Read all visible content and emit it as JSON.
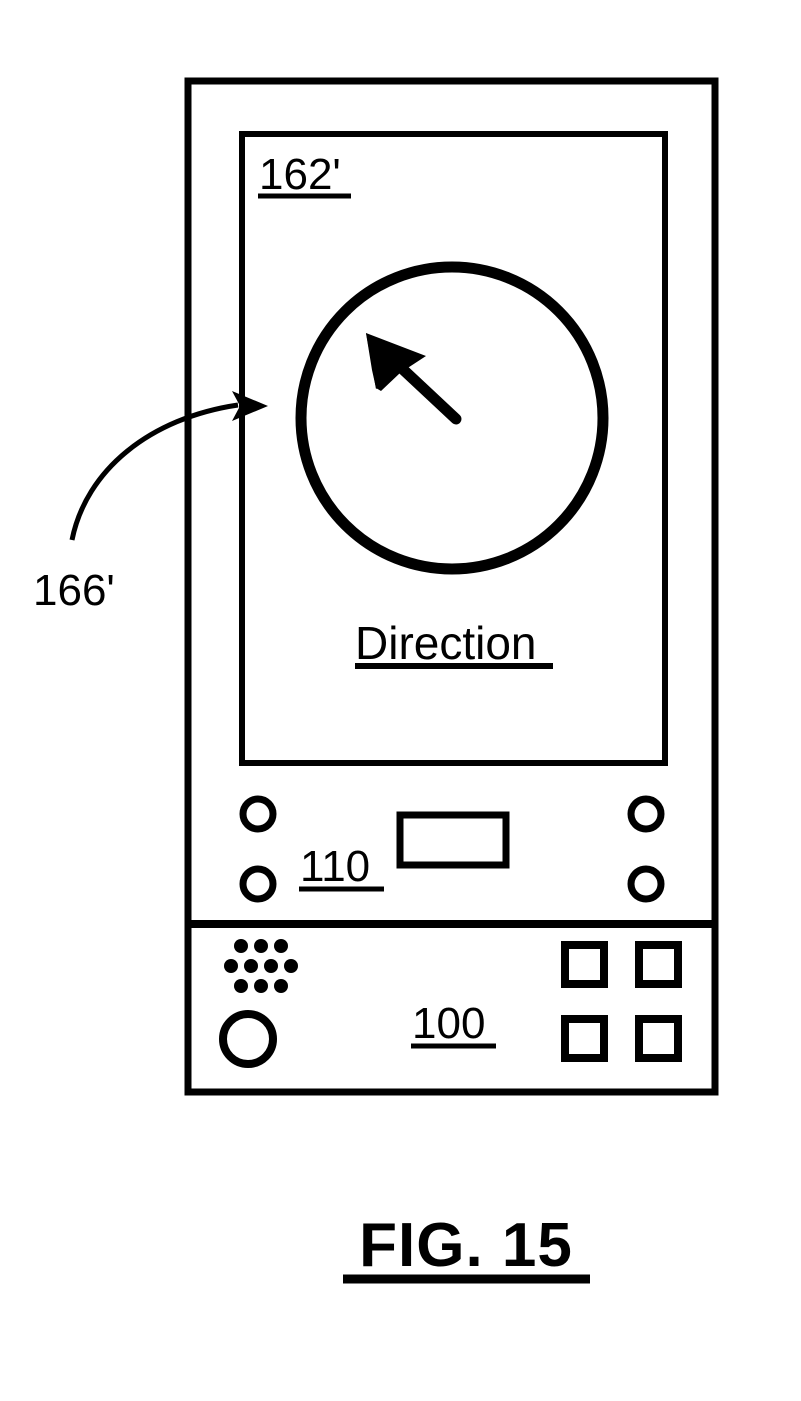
{
  "figure": {
    "caption": "FIG. 15",
    "caption_underline": true
  },
  "device": {
    "reference_numeral": "100",
    "display_assembly_numeral": "110",
    "screen": {
      "reference_numeral": "162'",
      "content_label": "Direction",
      "widget": "compass-dial",
      "pointer": "direction-arrow"
    },
    "callout": {
      "reference_numeral": "166'",
      "leader": "curved-arrow-to-screen-edge"
    },
    "controls": {
      "left_buttons": [
        "button-top-left",
        "button-bottom-left"
      ],
      "right_buttons": [
        "button-top-right",
        "button-bottom-right"
      ],
      "center_button": "center-rectangular-key"
    },
    "base": {
      "speaker": "speaker-dot-grid",
      "microphone": "microphone-circle",
      "keypad": [
        "key-1",
        "key-2",
        "key-3",
        "key-4"
      ]
    }
  },
  "colors": {
    "ink": "#000000",
    "paper": "#ffffff"
  }
}
